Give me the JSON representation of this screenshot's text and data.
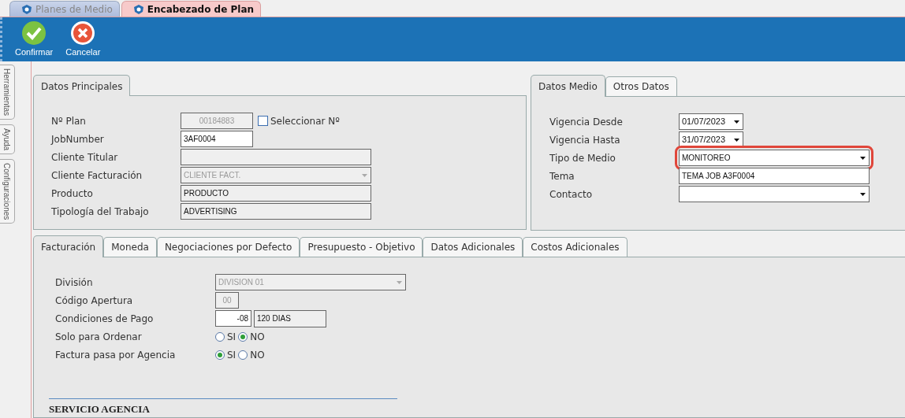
{
  "document_tabs": [
    {
      "label": "Planes de Medio",
      "selected": false
    },
    {
      "label": "Encabezado de Plan",
      "selected": true
    }
  ],
  "toolbar": [
    {
      "kind": "confirm",
      "label": "Confirmar"
    },
    {
      "kind": "cancel",
      "label": "Cancelar"
    }
  ],
  "side_tabs": [
    "Herramientas",
    "Ayuda",
    "Configuraciones"
  ],
  "main_panel": {
    "tabs": [
      {
        "label": "Datos Principales",
        "selected": true
      }
    ],
    "fields": [
      {
        "label": "Nº Plan",
        "kind": "short",
        "value": "00184883",
        "disabled": true,
        "checkbox": {
          "label": "Seleccionar Nº",
          "checked": false
        }
      },
      {
        "label": "JobNumber",
        "kind": "short",
        "value": "3AF0004",
        "disabled": false,
        "readonly": false
      },
      {
        "label": "Cliente Titular",
        "kind": "text",
        "disabled": false,
        "readonly": true
      },
      {
        "label": "Cliente Facturación",
        "kind": "combo",
        "value": "CLIENTE FACT.",
        "disabled": true
      },
      {
        "label": "Producto",
        "kind": "text",
        "value": "PRODUCTO",
        "disabled": false,
        "readonly": true
      },
      {
        "label": "Tipología del Trabajo",
        "kind": "text",
        "value": "ADVERTISING",
        "disabled": false,
        "readonly": true
      }
    ]
  },
  "media_panel": {
    "tabs": [
      {
        "label": "Datos Medio",
        "selected": true
      },
      {
        "label": "Otros Datos",
        "selected": false
      }
    ],
    "fields": [
      {
        "label": "Vigencia Desde",
        "kind": "date",
        "value": "01/07/2023",
        "disabled": false,
        "readonly": false
      },
      {
        "label": "Vigencia Hasta",
        "kind": "date",
        "value": "31/07/2023",
        "disabled": false,
        "readonly": false
      },
      {
        "label": "Tipo de Medio",
        "kind": "combo",
        "value": "MONITOREO",
        "disabled": false,
        "readonly": false,
        "highlighted": true
      },
      {
        "label": "Tema",
        "kind": "text",
        "value": "TEMA JOB A3F0004",
        "disabled": false,
        "readonly": false
      },
      {
        "label": "Contacto",
        "kind": "combo",
        "disabled": false,
        "readonly": false
      }
    ]
  },
  "billing_panel": {
    "tabs": [
      {
        "label": "Facturación",
        "selected": true
      },
      {
        "label": "Moneda",
        "selected": false
      },
      {
        "label": "Negociaciones por Defecto",
        "selected": false
      },
      {
        "label": "Presupuesto - Objetivo",
        "selected": false
      },
      {
        "label": "Datos Adicionales",
        "selected": false
      },
      {
        "label": "Costos Adicionales",
        "selected": false
      }
    ],
    "fields": [
      {
        "label": "División",
        "kind": "combo",
        "value": "DIVISION 01",
        "disabled": true
      },
      {
        "label": "Código Apertura",
        "kind": "tiny",
        "value": "00",
        "disabled": true
      },
      {
        "label": "Condiciones de Pago",
        "kind": "pair",
        "value": "-08",
        "second_value": "120 DIAS",
        "disabled": false,
        "readonly": false
      },
      {
        "label": "Solo para Ordenar",
        "kind": "radio",
        "options": [
          {
            "label": "SI",
            "selected": false
          },
          {
            "label": "NO",
            "selected": true
          }
        ]
      },
      {
        "label": "Factura pasa por Agencia",
        "kind": "radio",
        "options": [
          {
            "label": "SI",
            "selected": true
          },
          {
            "label": "NO",
            "selected": false
          }
        ]
      }
    ],
    "section_title": "SERVICIO AGENCIA"
  }
}
